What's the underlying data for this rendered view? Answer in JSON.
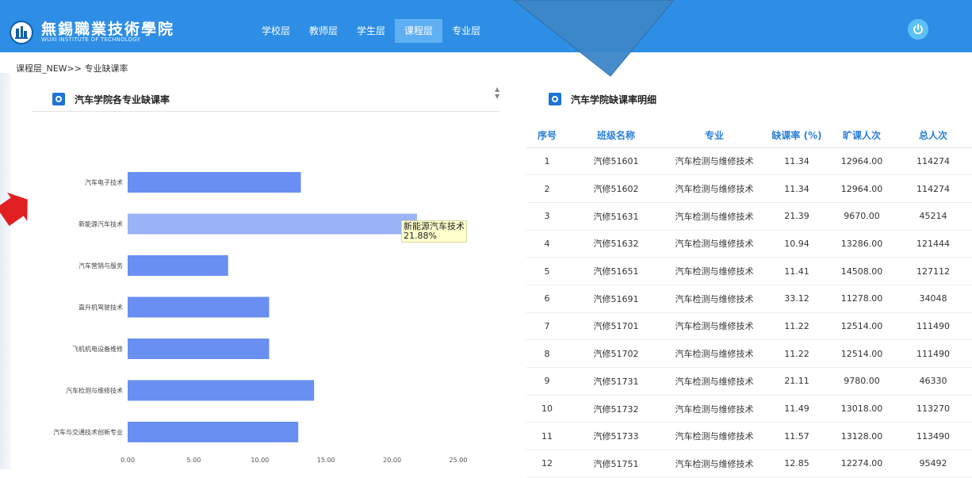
{
  "header": {
    "school_name": "無錫職業技術學院",
    "school_sub": "WUXI INSTITUTE OF TECHNOLOGY",
    "nav": [
      {
        "label": "学校层",
        "active": false
      },
      {
        "label": "教师层",
        "active": false
      },
      {
        "label": "学生层",
        "active": false
      },
      {
        "label": "课程层",
        "active": true
      },
      {
        "label": "专业层",
        "active": false
      }
    ]
  },
  "breadcrumb": "课程层_NEW>> 专业缺课率",
  "left_panel": {
    "title": "汽车学院各专业缺课率"
  },
  "right_panel": {
    "title": "汽车学院缺课率明细"
  },
  "tooltip": {
    "name": "新能源汽车技术",
    "value": "21.88%"
  },
  "chart_data": {
    "type": "bar",
    "orientation": "horizontal",
    "categories": [
      "汽车电子技术",
      "新能源汽车技术",
      "汽车营销与服务",
      "直升机驾驶技术",
      "飞机机电设备维修",
      "汽车检测与维修技术",
      "汽车与交通技术创新专业"
    ],
    "values": [
      13.1,
      21.88,
      7.6,
      10.7,
      10.7,
      14.1,
      12.9
    ],
    "highlight_index": 1,
    "x_ticks": [
      "0.00",
      "5.00",
      "10.00",
      "15.00",
      "20.00",
      "25.00"
    ],
    "xlim": [
      0,
      25
    ],
    "bar_color": "#6a8ff2",
    "highlight_color": "#9ab2f6"
  },
  "table": {
    "columns": [
      "序号",
      "班级名称",
      "专业",
      "缺课率 (%)",
      "旷课人次",
      "总人次"
    ],
    "rows": [
      [
        "1",
        "汽修51601",
        "汽车检测与维修技术",
        "11.34",
        "12964.00",
        "114274"
      ],
      [
        "2",
        "汽修51602",
        "汽车检测与维修技术",
        "11.34",
        "12964.00",
        "114274"
      ],
      [
        "3",
        "汽修51631",
        "汽车检测与维修技术",
        "21.39",
        "9670.00",
        "45214"
      ],
      [
        "4",
        "汽修51632",
        "汽车检测与维修技术",
        "10.94",
        "13286.00",
        "121444"
      ],
      [
        "5",
        "汽修51651",
        "汽车检测与维修技术",
        "11.41",
        "14508.00",
        "127112"
      ],
      [
        "6",
        "汽修51691",
        "汽车检测与维修技术",
        "33.12",
        "11278.00",
        "34048"
      ],
      [
        "7",
        "汽修51701",
        "汽车检测与维修技术",
        "11.22",
        "12514.00",
        "111490"
      ],
      [
        "8",
        "汽修51702",
        "汽车检测与维修技术",
        "11.22",
        "12514.00",
        "111490"
      ],
      [
        "9",
        "汽修51731",
        "汽车检测与维修技术",
        "21.11",
        "9780.00",
        "46330"
      ],
      [
        "10",
        "汽修51732",
        "汽车检测与维修技术",
        "11.49",
        "13018.00",
        "113270"
      ],
      [
        "11",
        "汽修51733",
        "汽车检测与维修技术",
        "11.57",
        "13128.00",
        "113490"
      ],
      [
        "12",
        "汽修51751",
        "汽车检测与维修技术",
        "12.85",
        "12274.00",
        "95492"
      ]
    ]
  },
  "colors": {
    "header_bg": "#2e8ee6",
    "nav_active": "#5fb0f2",
    "accent": "#2a7fd8",
    "bar": "#6a8ff2"
  }
}
